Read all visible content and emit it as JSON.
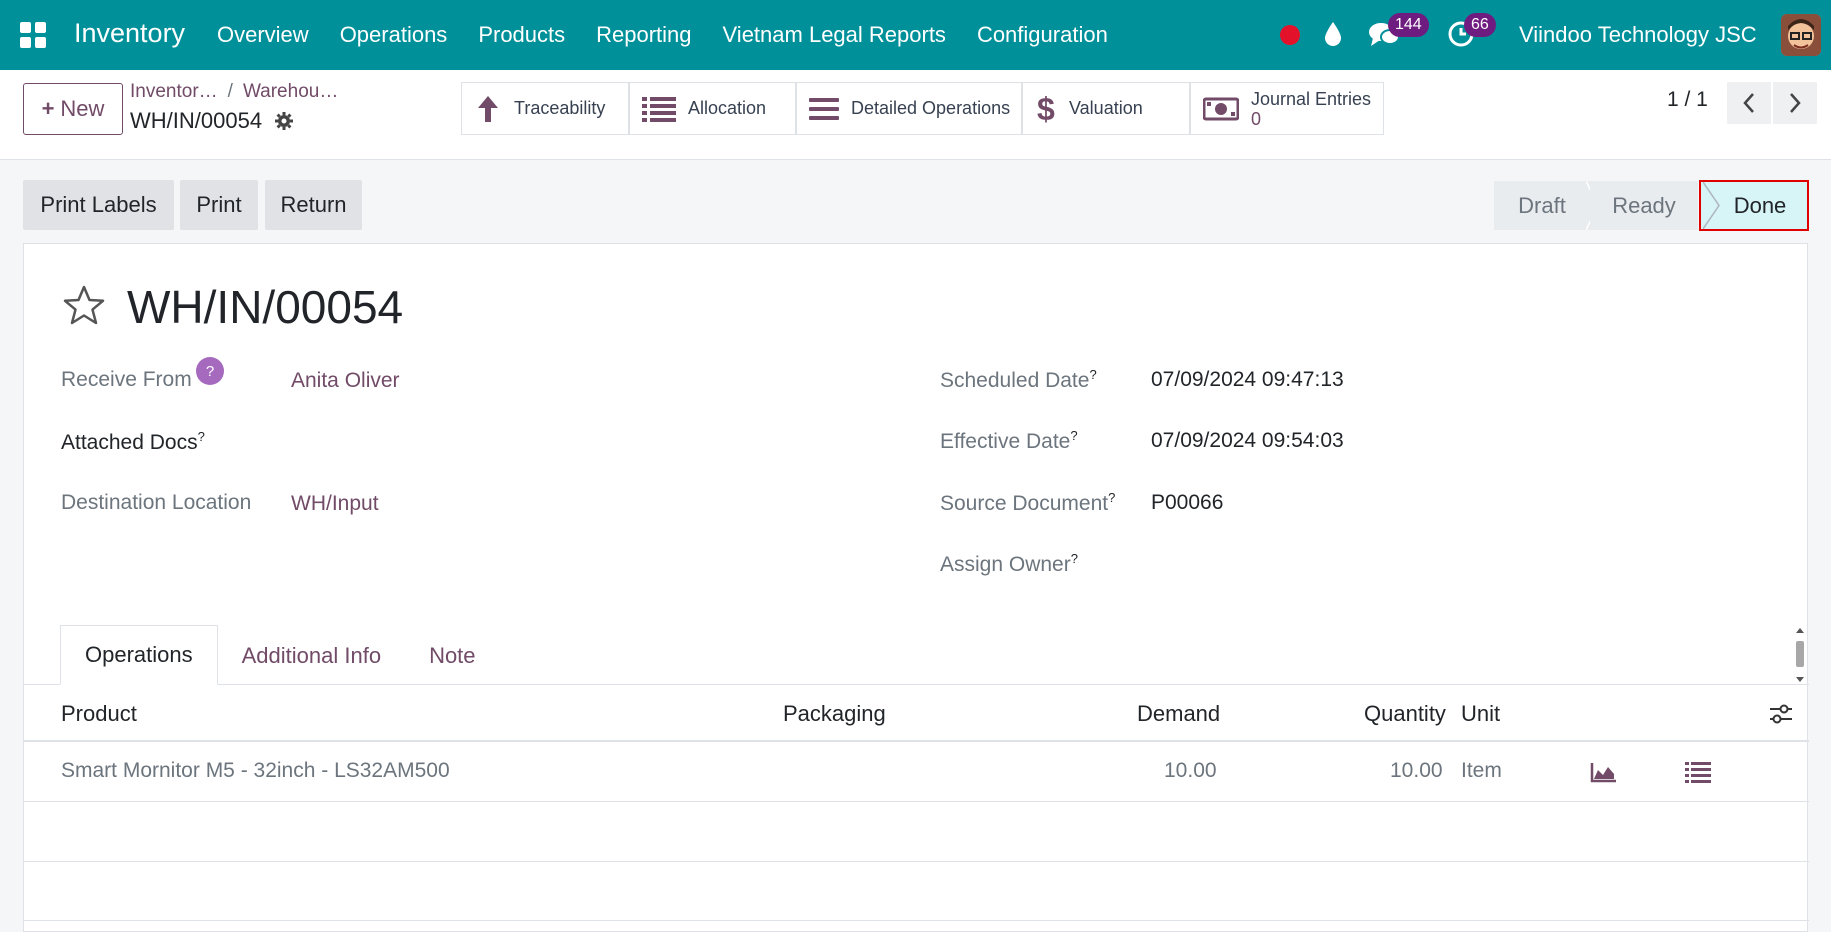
{
  "navbar": {
    "app_name": "Inventory",
    "menu": [
      "Overview",
      "Operations",
      "Products",
      "Reporting",
      "Vietnam Legal Reports",
      "Configuration"
    ],
    "messages_count": "144",
    "activities_count": "66",
    "company": "Viindoo Technology JSC",
    "bg_color": "#00909a"
  },
  "control_panel": {
    "new_label": "New",
    "breadcrumb": [
      "Inventor…",
      "Warehou…"
    ],
    "breadcrumb_sep": "/",
    "record_name": "WH/IN/00054",
    "smart_buttons": {
      "traceability": "Traceability",
      "allocation": "Allocation",
      "detailed_operations": "Detailed Operations",
      "valuation": "Valuation",
      "journal_entries": "Journal Entries",
      "journal_entries_count": "0"
    },
    "pager": "1 / 1"
  },
  "statusbar": {
    "buttons": {
      "print_labels": "Print Labels",
      "print": "Print",
      "return": "Return"
    },
    "stages": {
      "draft": "Draft",
      "ready": "Ready",
      "done": "Done"
    },
    "current_stage": "Done"
  },
  "form": {
    "title": "WH/IN/00054",
    "receive_from_label": "Receive From",
    "receive_from_value": "Anita Oliver",
    "help_mark": "?",
    "attached_docs_label": "Attached Docs",
    "destination_label": "Destination Location",
    "destination_value": "WH/Input",
    "scheduled_date_label": "Scheduled Date",
    "scheduled_date_value": "07/09/2024 09:47:13",
    "effective_date_label": "Effective Date",
    "effective_date_value": "07/09/2024 09:54:03",
    "source_document_label": "Source Document",
    "source_document_value": "P00066",
    "assign_owner_label": "Assign Owner",
    "tooltip_mark": "?"
  },
  "tabs": [
    "Operations",
    "Additional Info",
    "Note"
  ],
  "table": {
    "headers": {
      "product": "Product",
      "packaging": "Packaging",
      "demand": "Demand",
      "quantity": "Quantity",
      "unit": "Unit"
    },
    "rows": [
      {
        "product": "Smart Mornitor M5 - 32inch - LS32AM500",
        "packaging": "",
        "demand": "10.00",
        "quantity": "10.00",
        "unit": "Item"
      }
    ]
  },
  "colors": {
    "accent": "#714b67",
    "done_highlight": "#e00000"
  }
}
